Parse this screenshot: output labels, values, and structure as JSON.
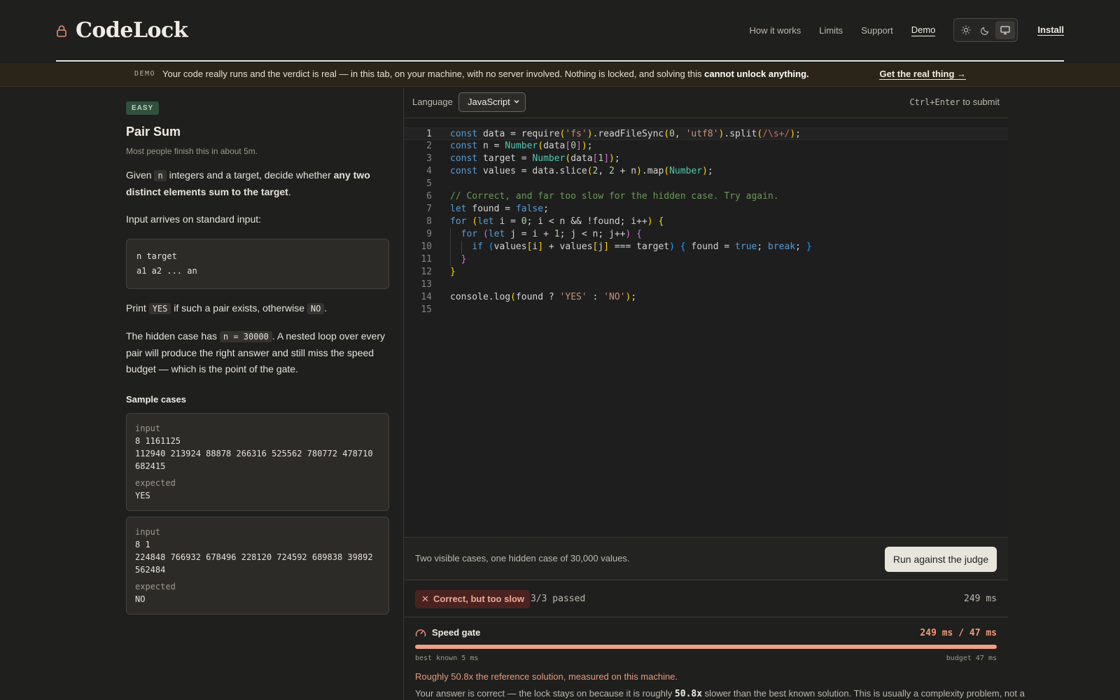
{
  "header": {
    "brand": "CodeLock",
    "nav": [
      "How it works",
      "Limits",
      "Support",
      "Demo"
    ],
    "active_nav": "Demo",
    "theme_options": [
      "sun-icon",
      "moon-icon",
      "monitor-icon"
    ],
    "selected_theme": "monitor-icon",
    "install": "Install"
  },
  "banner": {
    "tag": "DEMO",
    "text": "Your code really runs and the verdict is real — in this tab, on your machine, with no server involved. Nothing is locked, and solving this ",
    "text_bold": "cannot unlock anything.",
    "link": "Get the real thing →"
  },
  "problem": {
    "difficulty": "EASY",
    "title": "Pair Sum",
    "eta": "Most people finish this in about 5m.",
    "p1_a": "Given ",
    "p1_code": "n",
    "p1_b": " integers and a target, decide whether ",
    "p1_bold": "any two distinct elements sum to the target",
    "p1_c": ".",
    "p2": "Input arrives on standard input:",
    "input_format": [
      "n target",
      "a1 a2 ... an"
    ],
    "p3_a": "Print ",
    "p3_code1": "YES",
    "p3_b": " if such a pair exists, otherwise ",
    "p3_code2": "NO",
    "p3_c": ".",
    "p4_a": "The hidden case has ",
    "p4_code": "n = 30000",
    "p4_b": ". A nested loop over every pair will produce the right answer and still miss the speed budget — which is the point of the gate.",
    "samples_heading": "Sample cases",
    "samples": [
      {
        "input_label": "input",
        "input": "8 1161125\n112940 213924 88878 266316 525562 780772 478710\n682415",
        "expected_label": "expected",
        "expected": "YES"
      },
      {
        "input_label": "input",
        "input": "8 1\n224848 766932 678496 228120 724592 689838 39892\n562484",
        "expected_label": "expected",
        "expected": "NO"
      }
    ]
  },
  "editor": {
    "language_label": "Language",
    "language": "JavaScript",
    "shortcut_key": "Ctrl+Enter",
    "shortcut_text": "to submit",
    "current_line": 1,
    "lines": [
      "const data = require('fs').readFileSync(0, 'utf8').split(/\\s+/);",
      "const n = Number(data[0]);",
      "const target = Number(data[1]);",
      "const values = data.slice(2, 2 + n).map(Number);",
      "",
      "// Correct, and far too slow for the hidden case. Try again.",
      "let found = false;",
      "for (let i = 0; i < n && !found; i++) {",
      "  for (let j = i + 1; j < n; j++) {",
      "    if (values[i] + values[j] === target) { found = true; break; }",
      "  }",
      "}",
      "",
      "console.log(found ? 'YES' : 'NO');",
      ""
    ]
  },
  "submit": {
    "note": "Two visible cases, one hidden case of 30,000 values.",
    "button": "Run against the judge"
  },
  "result": {
    "verdict": "Correct, but too slow",
    "passed": "3/3 passed",
    "time": "249 ms"
  },
  "gate": {
    "title": "Speed gate",
    "ratio": "249 ms / 47 ms",
    "progress": 1.0,
    "best_known": "best known 5  ms",
    "budget": "budget 47  ms",
    "multiplier": "Roughly 50.8x the reference solution, measured on this machine.",
    "explain_a": "Your answer is correct — the lock stays on because it is roughly ",
    "explain_code": "50.8x",
    "explain_b": " slower than the best known solution. This is usually a complexity problem, not a"
  },
  "colors": {
    "background": "#1f1f1d",
    "accent": "#e8e5dc",
    "error": "#f0a896",
    "gate_fill": "#ee9f86",
    "easy_badge": "#33503f"
  }
}
